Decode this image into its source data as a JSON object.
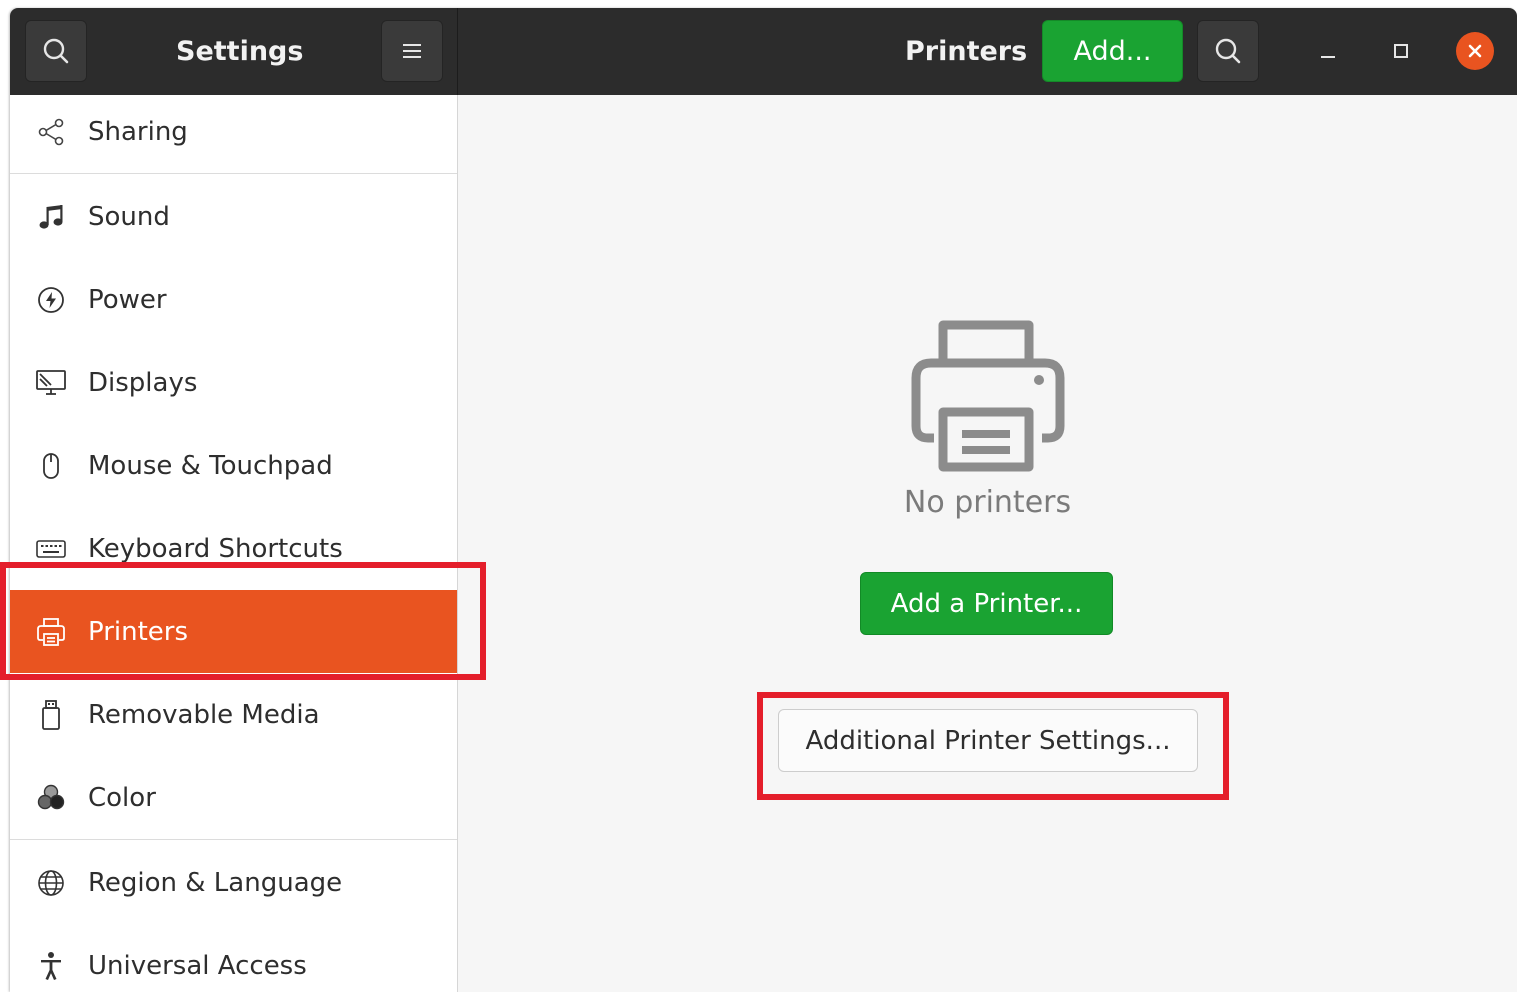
{
  "header": {
    "sidebar_title": "Settings",
    "page_title": "Printers",
    "add_button_label": "Add..."
  },
  "sidebar": {
    "items": [
      {
        "label": "Sharing",
        "icon": "share-icon"
      },
      {
        "label": "Sound",
        "icon": "music-note-icon"
      },
      {
        "label": "Power",
        "icon": "power-icon"
      },
      {
        "label": "Displays",
        "icon": "display-icon"
      },
      {
        "label": "Mouse & Touchpad",
        "icon": "mouse-icon"
      },
      {
        "label": "Keyboard Shortcuts",
        "icon": "keyboard-icon"
      },
      {
        "label": "Printers",
        "icon": "printer-icon",
        "active": true
      },
      {
        "label": "Removable Media",
        "icon": "removable-media-icon"
      },
      {
        "label": "Color",
        "icon": "color-icon"
      },
      {
        "label": "Region & Language",
        "icon": "globe-icon"
      },
      {
        "label": "Universal Access",
        "icon": "accessibility-icon"
      }
    ]
  },
  "main": {
    "empty_state_text": "No printers",
    "add_printer_label": "Add a Printer...",
    "additional_settings_label": "Additional Printer Settings..."
  },
  "colors": {
    "accent_orange": "#e95420",
    "button_green": "#1aa332",
    "highlight_red": "#e41e2b",
    "headerbar": "#2c2c2c"
  }
}
